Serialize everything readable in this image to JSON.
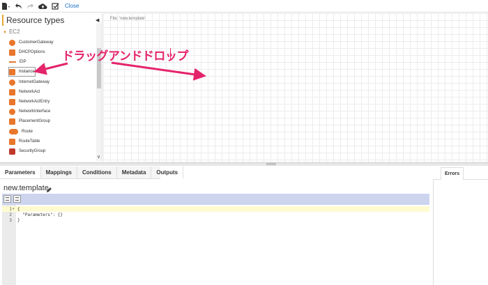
{
  "toolbar": {
    "close_label": "Close",
    "icons": [
      "file-icon",
      "undo-icon",
      "redo-icon",
      "cloud-upload-icon",
      "validate-icon"
    ]
  },
  "resource_panel": {
    "title": "Resource types",
    "group": "EC2",
    "items": [
      {
        "label": "CustomerGateway",
        "icon": "customer-gateway-icon"
      },
      {
        "label": "DHCPOptions",
        "icon": "dhcp-options-icon"
      },
      {
        "label": "EIP",
        "icon": "eip-icon"
      },
      {
        "label": "Instance",
        "icon": "instance-icon",
        "selected": true
      },
      {
        "label": "InternetGateway",
        "icon": "internet-gateway-icon"
      },
      {
        "label": "NetworkAcl",
        "icon": "network-acl-icon"
      },
      {
        "label": "NetworkAclEntry",
        "icon": "network-acl-entry-icon"
      },
      {
        "label": "NetworkInterface",
        "icon": "network-interface-icon"
      },
      {
        "label": "PlacementGroup",
        "icon": "placement-group-icon"
      },
      {
        "label": "Route",
        "icon": "route-icon"
      },
      {
        "label": "RouteTable",
        "icon": "route-table-icon"
      },
      {
        "label": "SecurityGroup",
        "icon": "security-group-icon"
      }
    ]
  },
  "canvas": {
    "file_label": "File: 'new.template'"
  },
  "annotation": {
    "text": "ドラッグアンドドロップ",
    "color": "#e4246b"
  },
  "bottom": {
    "tabs": [
      "Parameters",
      "Mappings",
      "Conditions",
      "Metadata",
      "Outputs"
    ],
    "active_tab": "Parameters",
    "filename": "new.template",
    "errors_tab": "Errors"
  },
  "editor": {
    "lines": [
      {
        "number": "1",
        "text": "{"
      },
      {
        "number": "2",
        "text": "  \"Parameters\": {}"
      },
      {
        "number": "3",
        "text": "}"
      }
    ]
  },
  "colors": {
    "accent": "#e3a72f",
    "resource_icon": "#e8762c",
    "security_group_icon": "#c0392b",
    "link": "#1a6fc7",
    "editor_toolbar": "#cdd4ee"
  }
}
